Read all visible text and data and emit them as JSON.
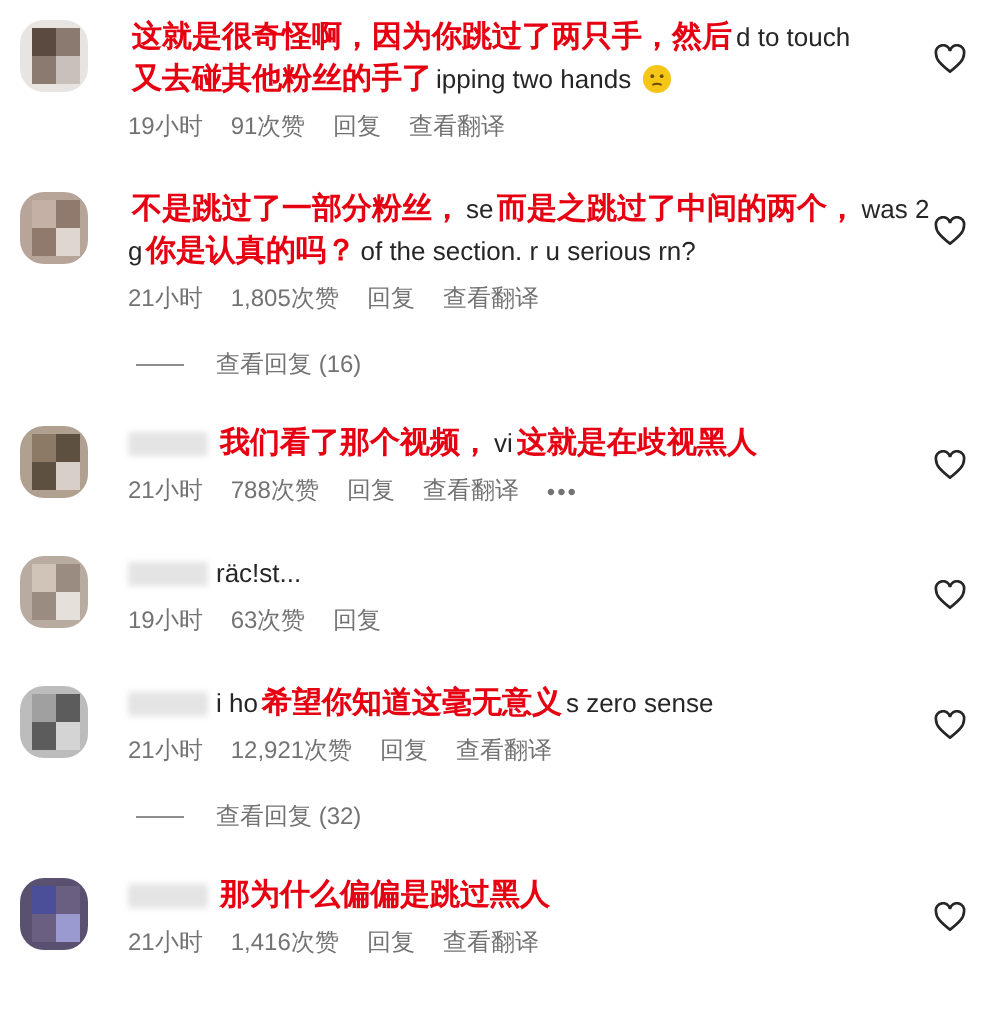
{
  "items": [
    {
      "kind": "comment",
      "lines": [
        [
          {
            "kind": "overlay",
            "text": "这就是很奇怪啊，因为你跳过了两只手，然后"
          },
          {
            "kind": "original",
            "text": "d to touch"
          }
        ],
        [
          {
            "kind": "overlay",
            "text": "又去碰其他粉丝的手了"
          },
          {
            "kind": "original",
            "text": "ipping two hands"
          },
          {
            "kind": "emoji"
          }
        ]
      ],
      "time": "19小时",
      "likes": "91次赞",
      "reply": "回复",
      "translate": "查看翻译"
    },
    {
      "kind": "comment",
      "lines": [
        [
          {
            "kind": "overlay",
            "text": "不是跳过了一部分粉丝，"
          },
          {
            "kind": "original",
            "text": "se"
          },
          {
            "kind": "overlay",
            "text": "而是之跳过了中间的两个，"
          },
          {
            "kind": "original",
            "text": "was 2"
          }
        ],
        [
          {
            "kind": "original",
            "text": "g"
          },
          {
            "kind": "overlay",
            "text": "你是认真的吗？"
          },
          {
            "kind": "original",
            "text": "of the section. r u serious rn?"
          }
        ]
      ],
      "time": "21小时",
      "likes": "1,805次赞",
      "reply": "回复",
      "translate": "查看翻译"
    },
    {
      "kind": "replies",
      "text": "查看回复 (16)"
    },
    {
      "kind": "comment",
      "lines": [
        [
          {
            "kind": "username"
          },
          {
            "kind": "overlay",
            "text": "我们看了那个视频，"
          },
          {
            "kind": "original",
            "text": "vi"
          },
          {
            "kind": "overlay",
            "text": "这就是在歧视黑人"
          }
        ]
      ],
      "time": "21小时",
      "likes": "788次赞",
      "reply": "回复",
      "translate": "查看翻译",
      "more": "•••"
    },
    {
      "kind": "comment",
      "lines": [
        [
          {
            "kind": "username"
          },
          {
            "kind": "original",
            "text": "räc!st..."
          }
        ]
      ],
      "time": "19小时",
      "likes": "63次赞",
      "reply": "回复"
    },
    {
      "kind": "comment",
      "lines": [
        [
          {
            "kind": "username"
          },
          {
            "kind": "original",
            "text": "i ho"
          },
          {
            "kind": "overlay",
            "text": "希望你知道这毫无意义"
          },
          {
            "kind": "original",
            "text": "s zero sense"
          }
        ]
      ],
      "time": "21小时",
      "likes": "12,921次赞",
      "reply": "回复",
      "translate": "查看翻译"
    },
    {
      "kind": "replies",
      "text": "查看回复 (32)"
    },
    {
      "kind": "comment",
      "lines": [
        [
          {
            "kind": "username"
          },
          {
            "kind": "overlay",
            "text": "那为什么偏偏是跳过黑人"
          }
        ]
      ],
      "time": "21小时",
      "likes": "1,416次赞",
      "reply": "回复",
      "translate": "查看翻译"
    }
  ]
}
